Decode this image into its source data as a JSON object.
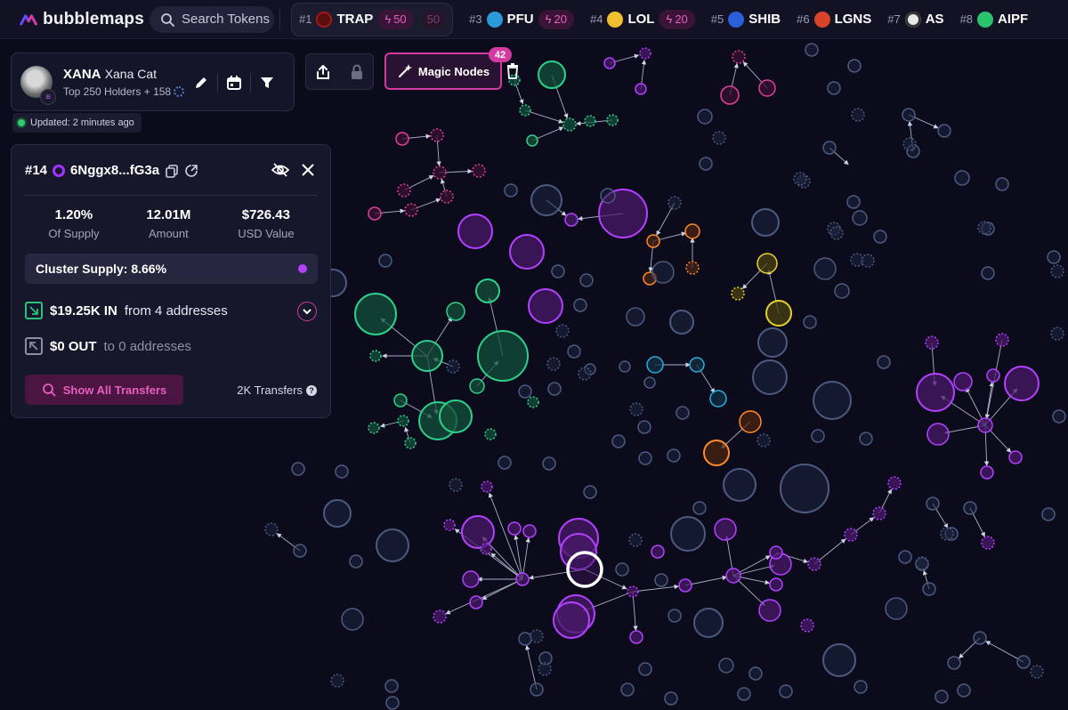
{
  "app": {
    "name": "bubblemaps"
  },
  "search": {
    "label": "Search Tokens"
  },
  "trending": [
    {
      "rank": "#1",
      "symbol": "TRAP",
      "boost": "50",
      "boost_dim": "50",
      "icon_color": "#5a0d0d",
      "active": true
    },
    {
      "rank": "#3",
      "symbol": "PFU",
      "boost": "20",
      "icon_color": "#2a9bd8"
    },
    {
      "rank": "#4",
      "symbol": "LOL",
      "boost": "20",
      "icon_color": "#f0c030"
    },
    {
      "rank": "#5",
      "symbol": "SHIB",
      "icon_color": "#2a5fd8"
    },
    {
      "rank": "#6",
      "symbol": "LGNS",
      "icon_color": "#d8442a"
    },
    {
      "rank": "#7",
      "symbol": "AS",
      "icon_color": "#e8e8e8"
    },
    {
      "rank": "#8",
      "symbol": "AIPF",
      "icon_color": "#2ac26a"
    }
  ],
  "token": {
    "symbol": "XANA",
    "name": "Xana Cat",
    "holders": "Top 250 Holders + 158"
  },
  "updated": "Updated: 2 minutes ago",
  "magic_nodes": {
    "label": "Magic Nodes",
    "count": "42"
  },
  "address": {
    "rank": "#14",
    "short": "6Nggx8...fG3a",
    "stats": [
      {
        "value": "1.20%",
        "label": "Of Supply"
      },
      {
        "value": "12.01M",
        "label": "Amount"
      },
      {
        "value": "$726.43",
        "label": "USD Value"
      }
    ],
    "cluster_supply": "Cluster Supply: 8.66%",
    "in_amount": "$19.25K IN",
    "in_from": "from 4 addresses",
    "out_amount": "$0 OUT",
    "out_to": "to 0 addresses",
    "show_all": "Show All Transfers",
    "transfers": "2K Transfers"
  },
  "colors": {
    "accent": "#d43aa0",
    "purple": "#a533ff",
    "green": "#29c27a",
    "background": "#0b0b1c"
  }
}
